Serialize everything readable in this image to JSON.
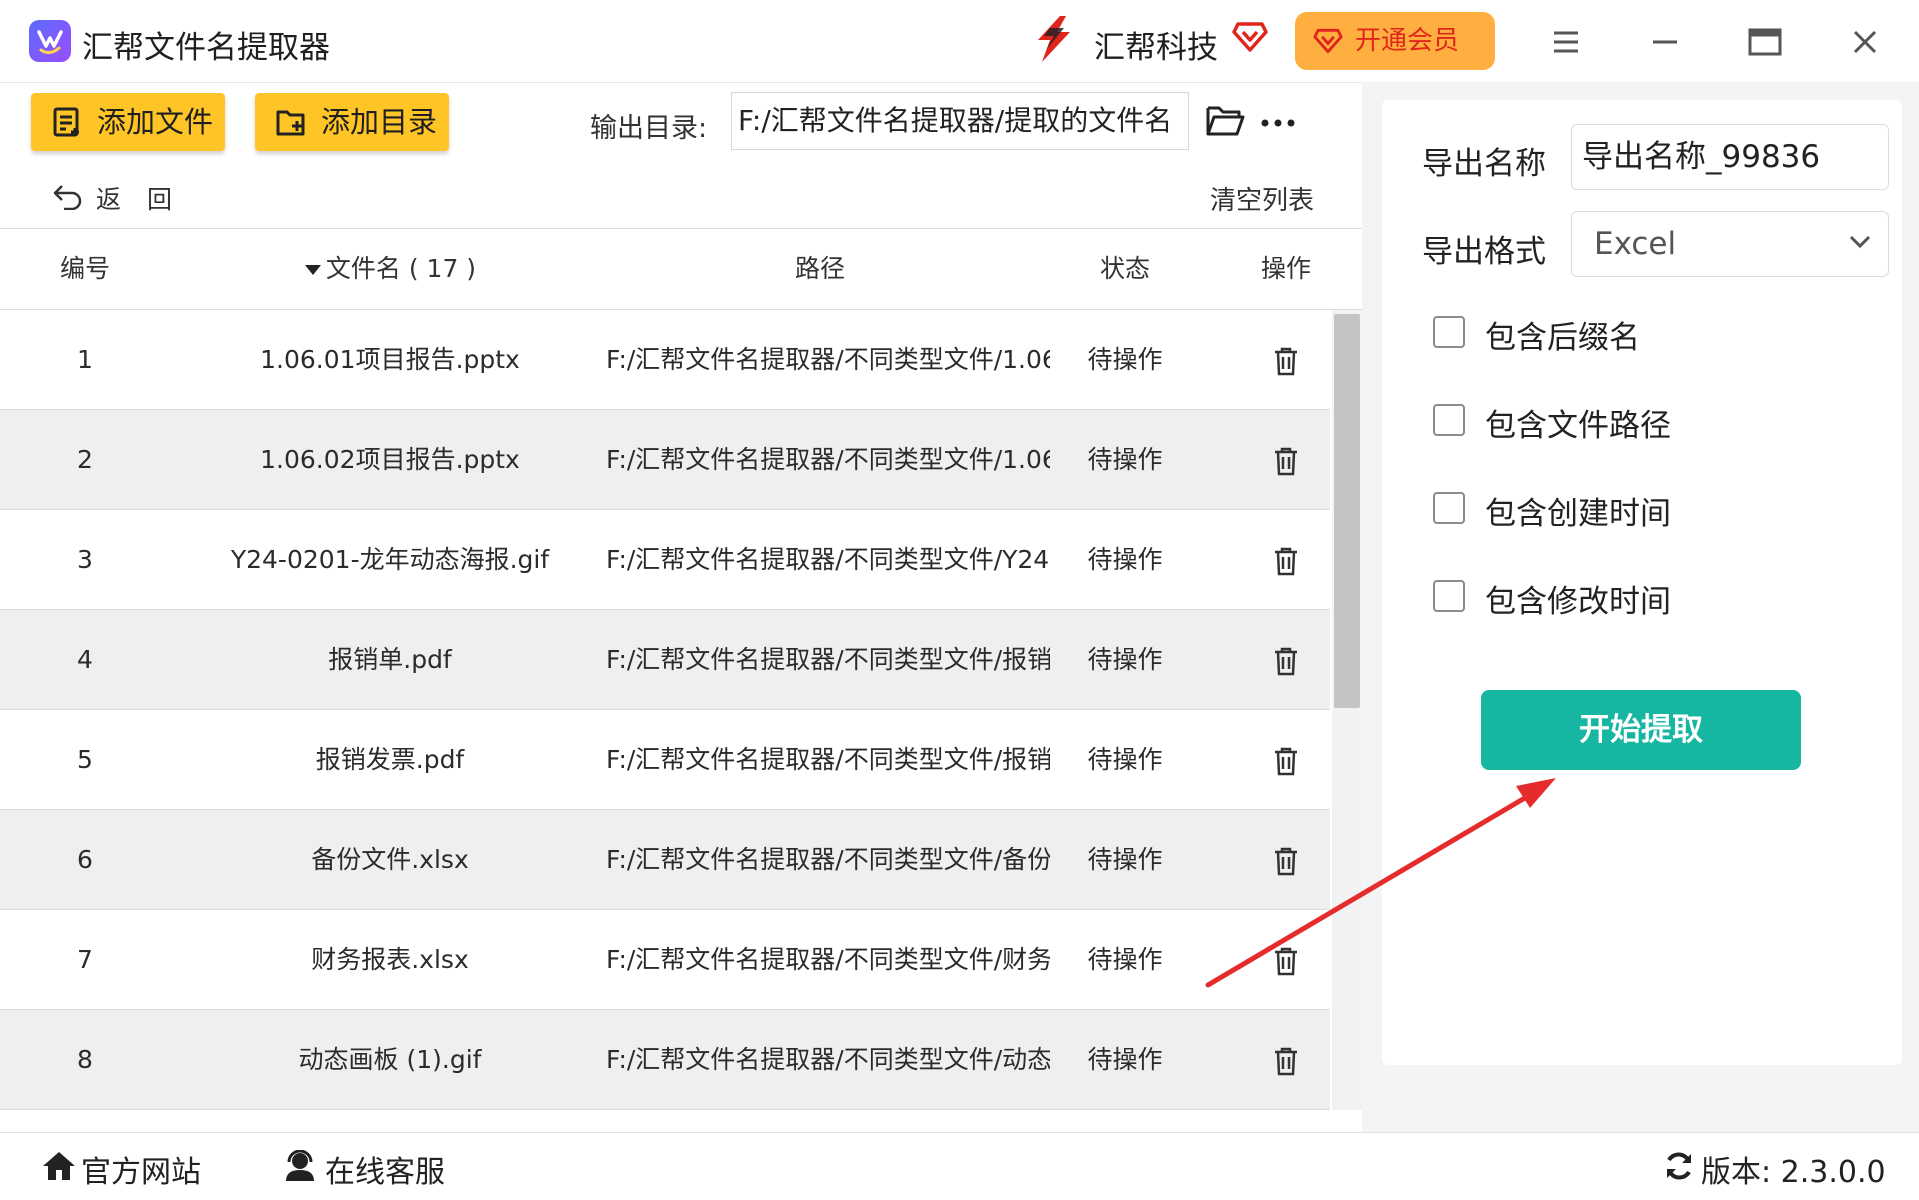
{
  "app": {
    "title": "汇帮文件名提取器",
    "brand": "汇帮科技",
    "vip_label": "开通会员"
  },
  "toolbar": {
    "add_file": "添加文件",
    "add_dir": "添加目录",
    "output_label": "输出目录:",
    "output_value": "F:/汇帮文件名提取器/提取的文件名",
    "back": "返回",
    "clear": "清空列表"
  },
  "table": {
    "headers": {
      "no": "编号",
      "name": "文件名 ( 17 )",
      "path": "路径",
      "status": "状态",
      "op": "操作"
    },
    "rows": [
      {
        "no": "1",
        "name": "1.06.01项目报告.pptx",
        "path": "F:/汇帮文件名提取器/不同类型文件/1.06",
        "status": "待操作"
      },
      {
        "no": "2",
        "name": "1.06.02项目报告.pptx",
        "path": "F:/汇帮文件名提取器/不同类型文件/1.06",
        "status": "待操作"
      },
      {
        "no": "3",
        "name": "Y24-0201-龙年动态海报.gif",
        "path": "F:/汇帮文件名提取器/不同类型文件/Y24-",
        "status": "待操作"
      },
      {
        "no": "4",
        "name": "报销单.pdf",
        "path": "F:/汇帮文件名提取器/不同类型文件/报销",
        "status": "待操作"
      },
      {
        "no": "5",
        "name": "报销发票.pdf",
        "path": "F:/汇帮文件名提取器/不同类型文件/报销",
        "status": "待操作"
      },
      {
        "no": "6",
        "name": "备份文件.xlsx",
        "path": "F:/汇帮文件名提取器/不同类型文件/备份",
        "status": "待操作"
      },
      {
        "no": "7",
        "name": "财务报表.xlsx",
        "path": "F:/汇帮文件名提取器/不同类型文件/财务",
        "status": "待操作"
      },
      {
        "no": "8",
        "name": "动态画板 (1).gif",
        "path": "F:/汇帮文件名提取器/不同类型文件/动态",
        "status": "待操作"
      }
    ]
  },
  "panel": {
    "export_name_label": "导出名称",
    "export_name_value": "导出名称_99836",
    "export_format_label": "导出格式",
    "export_format_value": "Excel",
    "options": [
      {
        "label": "包含后缀名",
        "checked": false
      },
      {
        "label": "包含文件路径",
        "checked": false
      },
      {
        "label": "包含创建时间",
        "checked": false
      },
      {
        "label": "包含修改时间",
        "checked": false
      }
    ],
    "start_label": "开始提取"
  },
  "footer": {
    "website": "官方网站",
    "support": "在线客服",
    "version": "版本: 2.3.0.0"
  },
  "colors": {
    "accent_yellow": "#ffc526",
    "vip_orange": "#ffaf3f",
    "start_teal": "#17b6a2",
    "arrow_red": "#e52b2b"
  },
  "icons": [
    "app-logo-icon",
    "brand-logo-icon",
    "diamond-icon",
    "menu-icon",
    "minimize-icon",
    "maximize-icon",
    "close-icon",
    "add-file-icon",
    "add-folder-icon",
    "folder-icon",
    "more-icon",
    "undo-icon",
    "sort-down-icon",
    "trash-icon",
    "chevron-down-icon",
    "home-icon",
    "headset-icon",
    "refresh-icon"
  ]
}
